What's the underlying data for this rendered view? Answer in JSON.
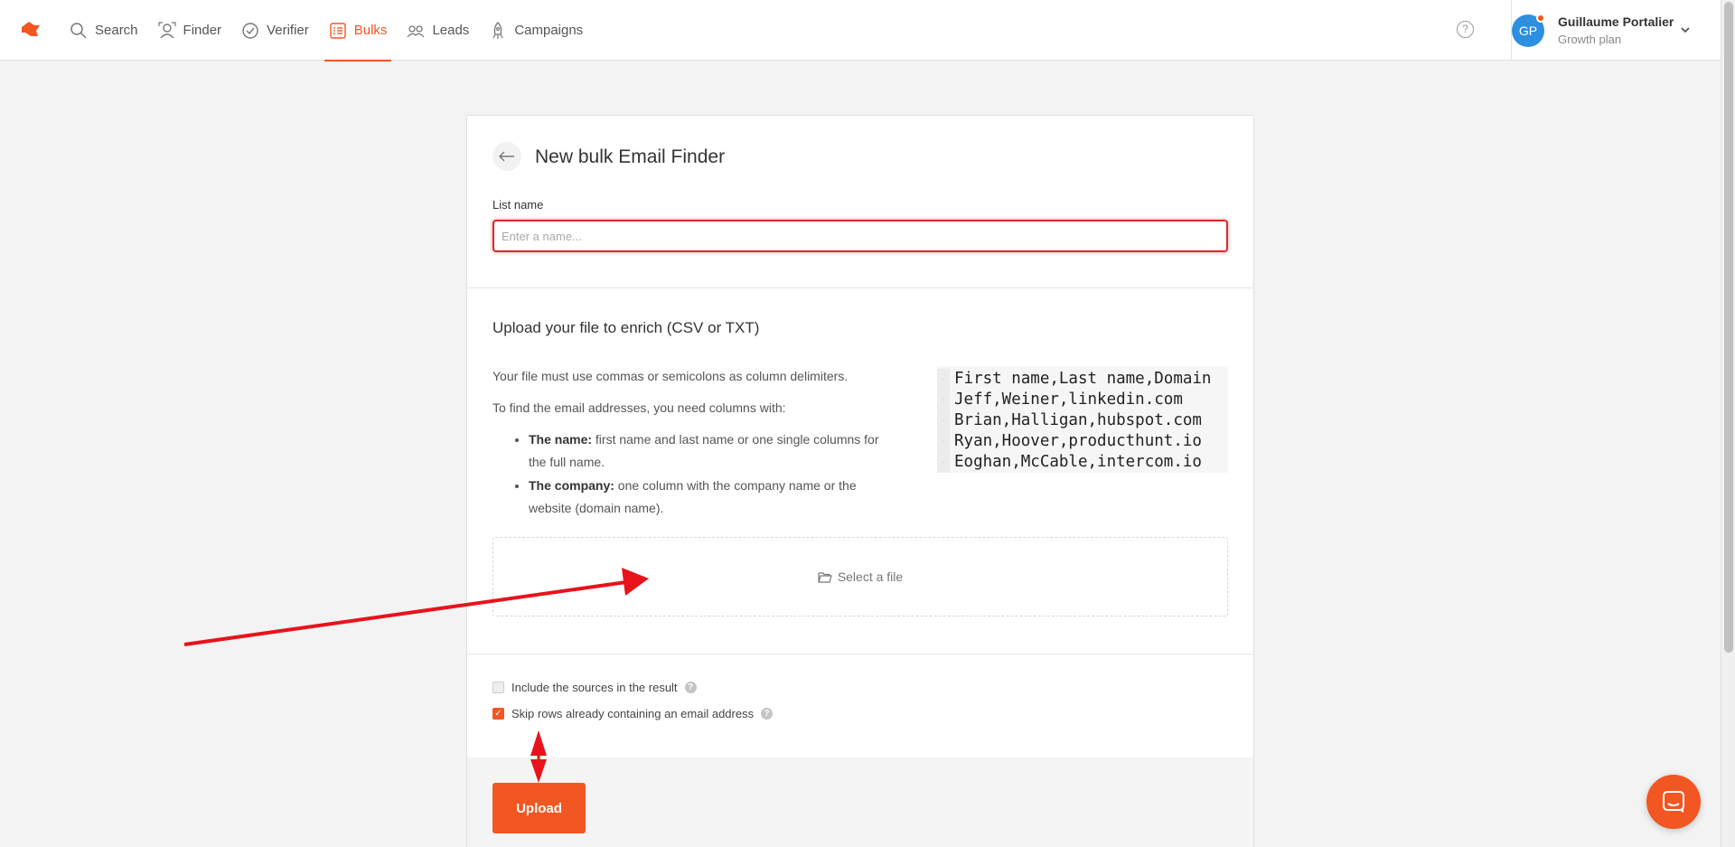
{
  "nav": {
    "items": [
      {
        "label": "Search",
        "icon": "search-icon"
      },
      {
        "label": "Finder",
        "icon": "finder-icon"
      },
      {
        "label": "Verifier",
        "icon": "verifier-icon"
      },
      {
        "label": "Bulks",
        "icon": "bulks-icon",
        "active": true
      },
      {
        "label": "Leads",
        "icon": "leads-icon"
      },
      {
        "label": "Campaigns",
        "icon": "campaigns-icon"
      }
    ],
    "help": "?"
  },
  "user": {
    "initials": "GP",
    "name": "Guillaume Portalier",
    "plan": "Growth plan"
  },
  "card": {
    "title": "New bulk Email Finder",
    "list_label": "List name",
    "list_placeholder": "Enter a name...",
    "upload_title": "Upload your file to enrich (CSV or TXT)",
    "desc1": "Your file must use commas or semicolons as column delimiters.",
    "desc2": "To find the email addresses, you need columns with:",
    "bullet1_bold": "The name:",
    "bullet1_text": " first name and last name or one single columns for the full name.",
    "bullet2_bold": "The company:",
    "bullet2_text": " one column with the company name or the website (domain name).",
    "code_lines": [
      "First name,Last name,Domain",
      "Jeff,Weiner,linkedin.com",
      "Brian,Halligan,hubspot.com",
      "Ryan,Hoover,producthunt.io",
      "Eoghan,McCable,intercom.io"
    ],
    "select_file": "Select a file",
    "include_sources": "Include the sources in the result",
    "skip_rows": "Skip rows already containing an email address",
    "upload_button": "Upload"
  },
  "colors": {
    "accent": "#f25622",
    "error": "#e0262a",
    "avatar": "#2d8fe0",
    "annotation_arrow": "#e8131b"
  }
}
